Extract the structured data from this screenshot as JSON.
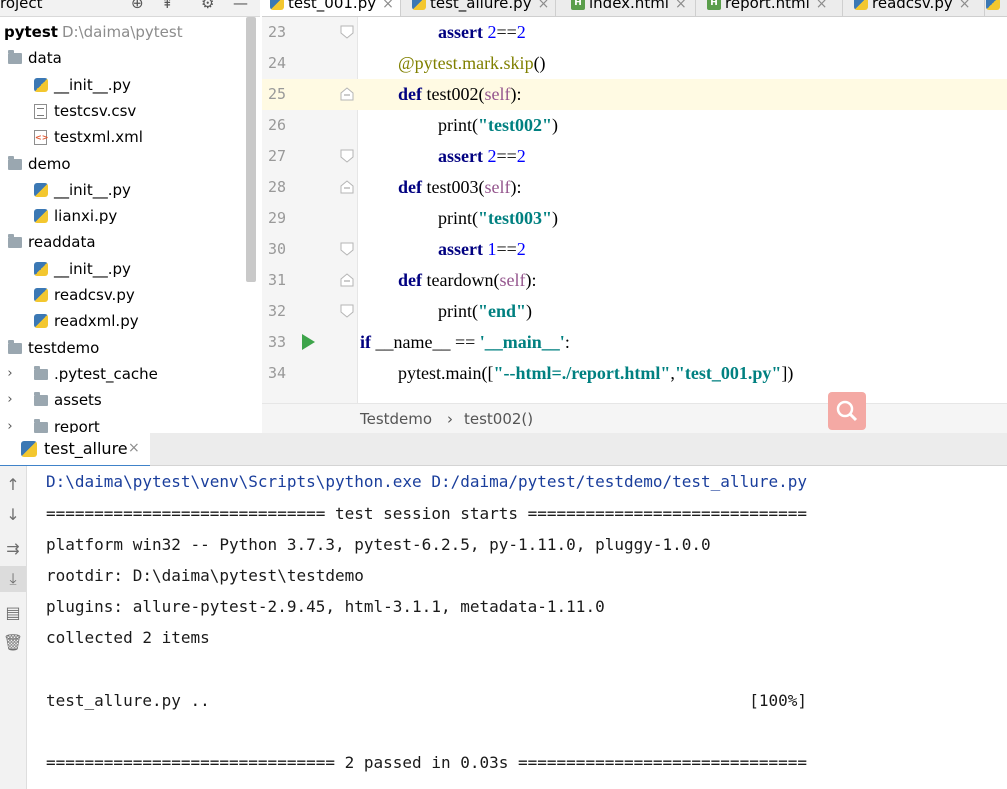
{
  "project": {
    "header_title": "roject",
    "tree": [
      {
        "label": "pytest",
        "path": "D:\\daima\\pytest",
        "kind": "root"
      },
      {
        "label": "data",
        "kind": "folder"
      },
      {
        "label": "__init__.py",
        "kind": "py"
      },
      {
        "label": "testcsv.csv",
        "kind": "csv"
      },
      {
        "label": "testxml.xml",
        "kind": "xml"
      },
      {
        "label": "demo",
        "kind": "folder"
      },
      {
        "label": "__init__.py",
        "kind": "py"
      },
      {
        "label": "lianxi.py",
        "kind": "py"
      },
      {
        "label": "readdata",
        "kind": "folder"
      },
      {
        "label": "__init__.py",
        "kind": "py"
      },
      {
        "label": "readcsv.py",
        "kind": "py"
      },
      {
        "label": "readxml.py",
        "kind": "py"
      },
      {
        "label": "testdemo",
        "kind": "folder"
      },
      {
        "label": ".pytest_cache",
        "kind": "folder"
      },
      {
        "label": "assets",
        "kind": "folder"
      },
      {
        "label": "report",
        "kind": "folder"
      }
    ]
  },
  "tabs": [
    {
      "label": "test_001.py",
      "icon": "python-icon",
      "active": true
    },
    {
      "label": "test_allure.py",
      "icon": "python-icon",
      "active": false
    },
    {
      "label": "index.html",
      "icon": "html-icon",
      "active": false
    },
    {
      "label": "report.html",
      "icon": "html-icon",
      "active": false
    },
    {
      "label": "readcsv.py",
      "icon": "python-icon",
      "active": false
    }
  ],
  "editor": {
    "line_numbers": [
      "23",
      "24",
      "25",
      "26",
      "27",
      "28",
      "29",
      "30",
      "31",
      "32",
      "33",
      "34"
    ],
    "current_line": "25",
    "run_gutter_line": "33"
  },
  "breadcrumb": {
    "class_name": "Testdemo",
    "separator": "›",
    "method_name": "test002()"
  },
  "run": {
    "tab_label": "test_allure",
    "console_lines": [
      "D:\\daima\\pytest\\venv\\Scripts\\python.exe D:/daima/pytest/testdemo/test_allure.py",
      "============================= test session starts =============================",
      "platform win32 -- Python 3.7.3, pytest-6.2.5, py-1.11.0, pluggy-1.0.0",
      "rootdir: D:\\daima\\pytest\\testdemo",
      "plugins: allure-pytest-2.9.45, html-3.1.1, metadata-1.11.0",
      "collected 2 items",
      "",
      "test_allure.py ..                                                        [100%]",
      "",
      "============================== 2 passed in 0.03s =============================="
    ]
  },
  "colors": {
    "accent": "#4083c9",
    "run_green": "#3da44a",
    "keyword": "#000080",
    "string": "#008080",
    "number": "#0000ff",
    "decorator": "#808000",
    "self": "#94558d"
  }
}
